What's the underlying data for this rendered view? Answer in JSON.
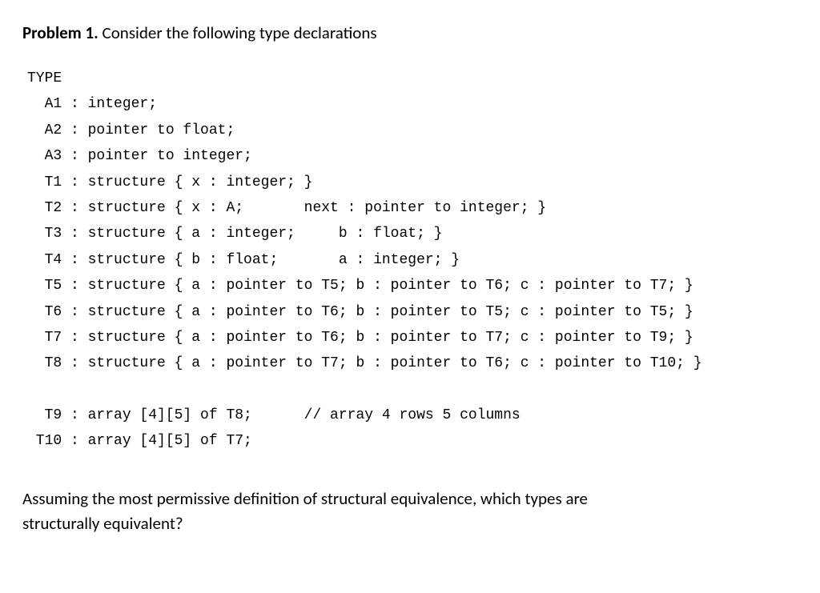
{
  "heading": {
    "label": "Problem 1.",
    "rest": " Consider the following type declarations"
  },
  "code": {
    "keyword": "TYPE",
    "lines": [
      "  A1 : integer;",
      "  A2 : pointer to float;",
      "  A3 : pointer to integer;",
      "  T1 : structure { x : integer; }",
      "  T2 : structure { x : A;       next : pointer to integer; }",
      "  T3 : structure { a : integer;     b : float; }",
      "  T4 : structure { b : float;       a : integer; }",
      "  T5 : structure { a : pointer to T5; b : pointer to T6; c : pointer to T7; }",
      "  T6 : structure { a : pointer to T6; b : pointer to T5; c : pointer to T5; }",
      "  T7 : structure { a : pointer to T6; b : pointer to T7; c : pointer to T9; }",
      "  T8 : structure { a : pointer to T7; b : pointer to T6; c : pointer to T10; }",
      "",
      "  T9 : array [4][5] of T8;      // array 4 rows 5 columns",
      " T10 : array [4][5] of T7;"
    ]
  },
  "question": {
    "line1": "Assuming the most permissive definition of structural equivalence, which types are",
    "line2": "structurally equivalent?"
  }
}
